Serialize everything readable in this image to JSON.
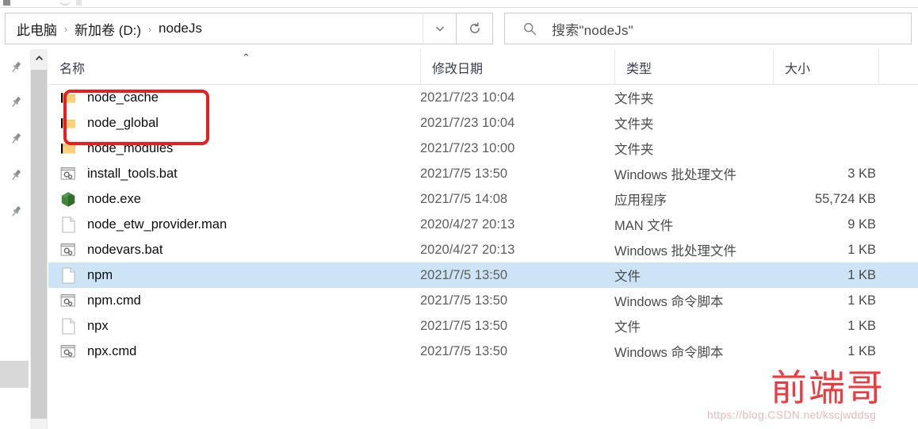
{
  "address_bar": {
    "breadcrumbs": [
      "此电脑",
      "新加卷 (D:)",
      "nodeJs"
    ],
    "separator": "›",
    "dropdown_icon": "chevron-down-icon",
    "refresh_icon": "refresh-icon"
  },
  "search": {
    "icon": "search-icon",
    "placeholder": "搜索\"nodeJs\"",
    "value": ""
  },
  "nav_rail": {
    "pin_icon": "pin-icon",
    "pin_count": 5
  },
  "scrollbar": {
    "up_arrow_icon": "chevron-up-icon"
  },
  "columns": [
    {
      "label": "名称",
      "key": "name"
    },
    {
      "label": "修改日期",
      "key": "date"
    },
    {
      "label": "类型",
      "key": "type"
    },
    {
      "label": "大小",
      "key": "size"
    }
  ],
  "sort": {
    "column": "名称",
    "direction": "asc",
    "caret": "⌃"
  },
  "files": [
    {
      "name": "node_cache",
      "date": "2021/7/23 10:04",
      "type": "文件夹",
      "size": "",
      "icon": "folder-icon",
      "selected": false
    },
    {
      "name": "node_global",
      "date": "2021/7/23 10:04",
      "type": "文件夹",
      "size": "",
      "icon": "folder-icon",
      "selected": false
    },
    {
      "name": "node_modules",
      "date": "2021/7/23 10:00",
      "type": "文件夹",
      "size": "",
      "icon": "folder-icon",
      "selected": false
    },
    {
      "name": "install_tools.bat",
      "date": "2021/7/5 13:50",
      "type": "Windows 批处理文件",
      "size": "3 KB",
      "icon": "bat-file-icon",
      "selected": false
    },
    {
      "name": "node.exe",
      "date": "2021/7/5 14:08",
      "type": "应用程序",
      "size": "55,724 KB",
      "icon": "nodejs-exe-icon",
      "selected": false
    },
    {
      "name": "node_etw_provider.man",
      "date": "2020/4/27 20:13",
      "type": "MAN 文件",
      "size": "9 KB",
      "icon": "generic-file-icon",
      "selected": false
    },
    {
      "name": "nodevars.bat",
      "date": "2020/4/27 20:13",
      "type": "Windows 批处理文件",
      "size": "1 KB",
      "icon": "bat-file-icon",
      "selected": false
    },
    {
      "name": "npm",
      "date": "2021/7/5 13:50",
      "type": "文件",
      "size": "1 KB",
      "icon": "generic-file-icon",
      "selected": true
    },
    {
      "name": "npm.cmd",
      "date": "2021/7/5 13:50",
      "type": "Windows 命令脚本",
      "size": "1 KB",
      "icon": "cmd-file-icon",
      "selected": false
    },
    {
      "name": "npx",
      "date": "2021/7/5 13:50",
      "type": "文件",
      "size": "1 KB",
      "icon": "generic-file-icon",
      "selected": false
    },
    {
      "name": "npx.cmd",
      "date": "2021/7/5 13:50",
      "type": "Windows 命令脚本",
      "size": "1 KB",
      "icon": "cmd-file-icon",
      "selected": false
    }
  ],
  "annotation": {
    "type": "red-rectangle",
    "color": "#ee1c1c",
    "targets": [
      "node_cache",
      "node_global"
    ]
  },
  "watermarks": {
    "brand": "前端哥",
    "brand_color": "#ef3a40",
    "url": "https://blog.CSDN.net/kscjwddsg"
  },
  "colors": {
    "selection": "#cce4f6",
    "folder": "#ffd179",
    "nodejs_green": "#3c873a",
    "header_text": "#3b3b52"
  }
}
